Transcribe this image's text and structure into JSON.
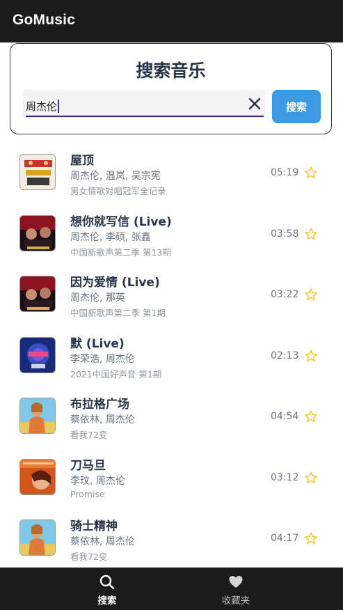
{
  "app": {
    "title": "GoMusic"
  },
  "search": {
    "heading": "搜索音乐",
    "query": "周杰伦",
    "button_label": "搜索"
  },
  "songs": [
    {
      "title": "屋顶",
      "artists": "周杰伦, 温岚, 吴宗宪",
      "album": "男女情歌对唱冠军全记录",
      "duration": "05:19"
    },
    {
      "title": "想你就写信 (Live)",
      "artists": "周杰伦, 李硕, 张鑫",
      "album": "中国新歌声第二季 第13期",
      "duration": "03:58"
    },
    {
      "title": "因为爱情 (Live)",
      "artists": "周杰伦, 那英",
      "album": "中国新歌声第二季 第1期",
      "duration": "03:22"
    },
    {
      "title": "默 (Live)",
      "artists": "李荣浩, 周杰伦",
      "album": "2021中国好声音 第1期",
      "duration": "02:13"
    },
    {
      "title": "布拉格广场",
      "artists": "蔡依林, 周杰伦",
      "album": "看我72变",
      "duration": "04:54"
    },
    {
      "title": "刀马旦",
      "artists": "李玟, 周杰伦",
      "album": "Promise",
      "duration": "03:12"
    },
    {
      "title": "骑士精神",
      "artists": "蔡依林, 周杰伦",
      "album": "看我72变",
      "duration": "04:17"
    }
  ],
  "nav": {
    "search_label": "搜索",
    "favorites_label": "收藏夹"
  },
  "colors": {
    "accent": "#3b9ae1",
    "star": "#f4c430",
    "bar": "#1b1b1b"
  },
  "icons": {
    "clear": "close-icon",
    "favorite": "star-outline-icon",
    "nav_search": "search-icon",
    "nav_fav": "heart-icon"
  }
}
